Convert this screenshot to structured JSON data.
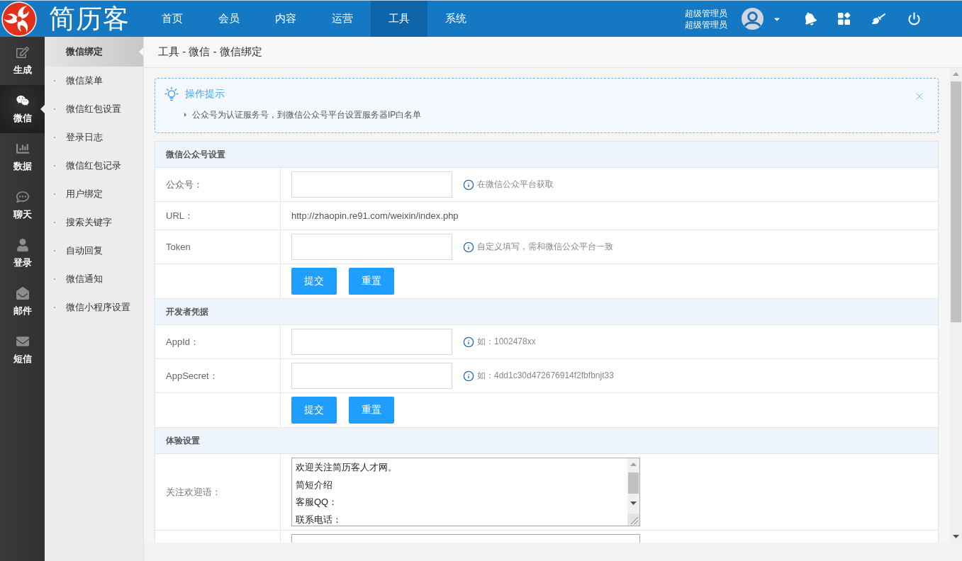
{
  "header": {
    "logo_text": "简历客",
    "nav": [
      {
        "label": "首页",
        "selected": false
      },
      {
        "label": "会员",
        "selected": false
      },
      {
        "label": "内容",
        "selected": false
      },
      {
        "label": "运营",
        "selected": false
      },
      {
        "label": "工具",
        "selected": true
      },
      {
        "label": "系统",
        "selected": false
      }
    ],
    "user": {
      "name": "超级管理员",
      "role": "超级管理员"
    }
  },
  "module_sidebar": [
    {
      "label": "生成",
      "selected": false
    },
    {
      "label": "微信",
      "selected": true
    },
    {
      "label": "数据",
      "selected": false
    },
    {
      "label": "聊天",
      "selected": false
    },
    {
      "label": "登录",
      "selected": false
    },
    {
      "label": "邮件",
      "selected": false
    },
    {
      "label": "短信",
      "selected": false
    }
  ],
  "menu": [
    {
      "label": "微信绑定",
      "selected": true
    },
    {
      "label": "微信菜单",
      "selected": false
    },
    {
      "label": "微信红包设置",
      "selected": false
    },
    {
      "label": "登录日志",
      "selected": false
    },
    {
      "label": "微信红包记录",
      "selected": false
    },
    {
      "label": "用户绑定",
      "selected": false
    },
    {
      "label": "搜索关键字",
      "selected": false
    },
    {
      "label": "自动回复",
      "selected": false
    },
    {
      "label": "微信通知",
      "selected": false
    },
    {
      "label": "微信小程序设置",
      "selected": false
    }
  ],
  "breadcrumb": "工具 - 微信 - 微信绑定",
  "tip": {
    "title": "操作提示",
    "items": [
      "公众号为认证服务号，到微信公众号平台设置服务器IP白名单"
    ]
  },
  "sections": [
    {
      "title": "微信公众号设置",
      "rows": [
        {
          "kind": "input",
          "label": "公众号：",
          "hint": "在微信公众平台获取"
        },
        {
          "kind": "text",
          "label": "URL：",
          "value": "http://zhaopin.re91.com/weixin/index.php"
        },
        {
          "kind": "input",
          "label": "Token",
          "hint": "自定义填写，需和微信公众平台一致"
        },
        {
          "kind": "buttons",
          "buttons": [
            "提交",
            "重置"
          ]
        }
      ]
    },
    {
      "title": "开发者凭据",
      "rows": [
        {
          "kind": "input",
          "label": "AppId：",
          "hint": "如：1002478xx"
        },
        {
          "kind": "input",
          "label": "AppSecret：",
          "hint": "如：4dd1c30d472676914f2fbfbnjt33"
        },
        {
          "kind": "buttons",
          "buttons": [
            "提交",
            "重置"
          ]
        }
      ]
    },
    {
      "title": "体验设置",
      "rows": [
        {
          "kind": "textarea",
          "label": "关注欢迎语：",
          "lines": [
            "欢迎关注简历客人才网。",
            "简短介绍",
            "客服QQ：",
            "联系电话："
          ]
        },
        {
          "kind": "textarea"
        }
      ]
    }
  ]
}
